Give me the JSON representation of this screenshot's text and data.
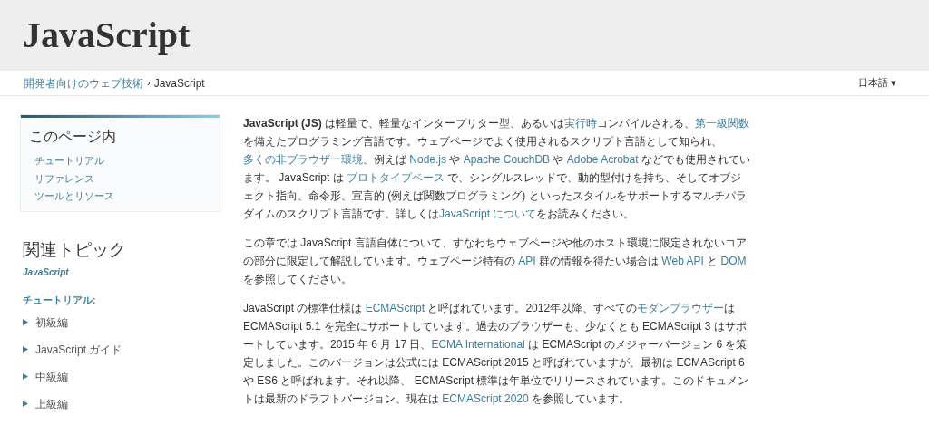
{
  "header": {
    "title": "JavaScript"
  },
  "breadcrumb": {
    "items": [
      {
        "text": "開発者向けのウェブ技術",
        "link": true
      },
      {
        "text": "JavaScript",
        "link": false
      }
    ],
    "separator": "›"
  },
  "language": {
    "label": "日本語",
    "caret": "▾"
  },
  "toc": {
    "title": "このページ内",
    "items": [
      "チュートリアル",
      "リファレンス",
      "ツールとリソース"
    ]
  },
  "related": {
    "title": "関連トピック",
    "topic": "JavaScript",
    "section": "チュートリアル:",
    "items": [
      {
        "label": "初級編",
        "expanded": false
      },
      {
        "label": "JavaScript ガイド",
        "expanded": false
      },
      {
        "label": "中級編",
        "expanded": false
      },
      {
        "label": "上級編",
        "expanded": false
      }
    ]
  },
  "content": {
    "paragraphs": [
      [
        {
          "text": "**JavaScript (JS)** は軽量で、軽量なインタープリター型、あるいは",
          "link": false
        },
        {
          "text": "実行時",
          "link": true
        },
        {
          "text": "コンパイルされる、",
          "link": false
        },
        {
          "text": "第一級関数",
          "link": true
        },
        {
          "text": "を備えたプログラミング言語です。ウェブページでよく使用されるスクリプト言語として知られ、",
          "link": false
        },
        {
          "text": "多くの非ブラウザー環境",
          "link": true
        },
        {
          "text": "、例えば ",
          "link": false
        },
        {
          "text": "Node.js",
          "link": true
        },
        {
          "text": " や ",
          "link": false
        },
        {
          "text": "Apache CouchDB",
          "link": true
        },
        {
          "text": " や ",
          "link": false
        },
        {
          "text": "Adobe Acrobat",
          "link": true
        },
        {
          "text": " などでも使用されています。 JavaScript は ",
          "link": false
        },
        {
          "text": "プロトタイプベース",
          "link": true
        },
        {
          "text": " で、シングルスレッドで、動的型付けを持ち、そしてオブジェクト指向、命令形、宣言的 (例えば関数プログラミング) といったスタイルをサポートするマルチパラダイムのスクリプト言語です。詳しくは",
          "link": false
        },
        {
          "text": "JavaScript について",
          "link": true
        },
        {
          "text": "をお読みください。",
          "link": false
        }
      ],
      [
        {
          "text": "この章では JavaScript 言語自体について、すなわちウェブページや他のホスト環境に限定されないコアの部分に限定して解説しています。ウェブページ特有の ",
          "link": false
        },
        {
          "text": "API",
          "link": true
        },
        {
          "text": " 群の情報を得たい場合は ",
          "link": false
        },
        {
          "text": "Web API",
          "link": true
        },
        {
          "text": " と ",
          "link": false
        },
        {
          "text": "DOM",
          "link": true
        },
        {
          "text": " を参照してください。",
          "link": false
        }
      ],
      [
        {
          "text": "JavaScript の標準仕様は ",
          "link": false
        },
        {
          "text": "ECMAScript",
          "link": true
        },
        {
          "text": " と呼ばれています。2012年以降、すべての",
          "link": false
        },
        {
          "text": "モダンブラウザー",
          "link": true
        },
        {
          "text": "は ECMAScript 5.1 を完全にサポートしています。過去のブラウザーも、少なくとも ECMAScript 3 はサポートしています。2015 年 6 月 17 日、",
          "link": false
        },
        {
          "text": "ECMA International",
          "link": true
        },
        {
          "text": " は ECMAScript のメジャーバージョン 6 を策定しました。このバージョンは公式には ECMAScript 2015 と呼ばれていますが、最初は ECMAScript 6 や ES6 と呼ばれます。それ以降、 ECMAScript 標準は年単位でリリースされています。このドキュメントは最新のドラフトバージョン、現在は ",
          "link": false
        },
        {
          "text": "ECMAScript 2020",
          "link": true
        },
        {
          "text": " を参照しています。",
          "link": false
        }
      ]
    ]
  }
}
